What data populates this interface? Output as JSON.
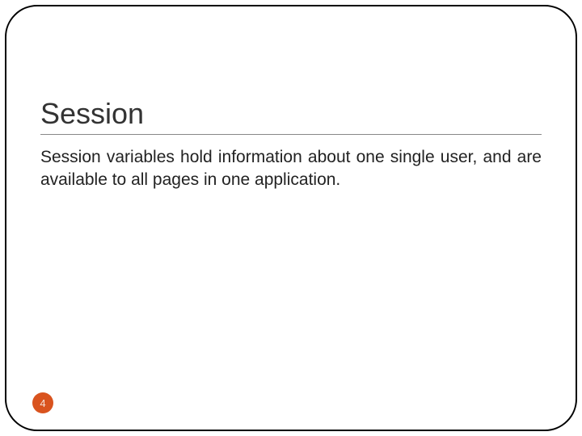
{
  "slide": {
    "title": "Session",
    "body": "Session variables hold information about one single user, and are available to all pages in one application.",
    "page_number": "4"
  }
}
